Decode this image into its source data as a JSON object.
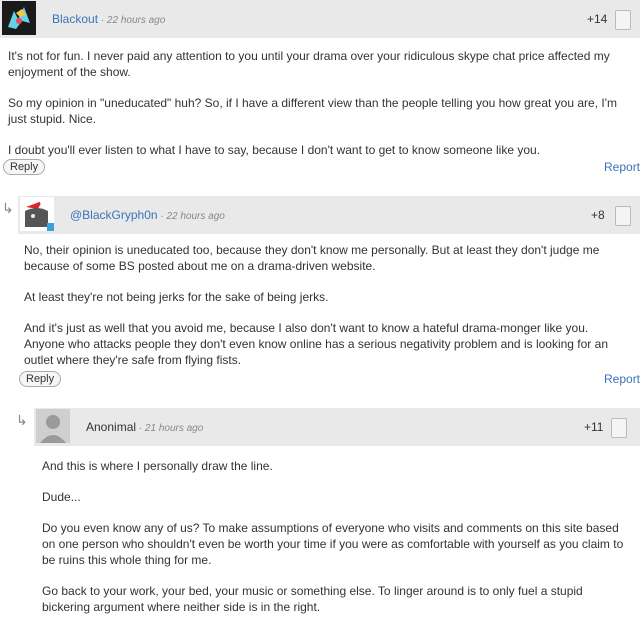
{
  "comments": [
    {
      "author": "Blackout",
      "time": "22 hours ago",
      "votes": "+14",
      "paragraphs": [
        "It's not for fun. I never paid any attention to you until your drama over your ridiculous skype chat price affected my enjoyment of the show.",
        "So my opinion in \"uneducated\" huh? So, if I have a different view than the people telling you how great you are, I'm just stupid. Nice.",
        "I doubt you'll ever listen to what I have to say, because I don't want to get to know someone like you."
      ],
      "reply_label": "Reply",
      "report_label": "Report"
    },
    {
      "author": "@BlackGryph0n",
      "time": "22 hours ago",
      "votes": "+8",
      "paragraphs": [
        "No, their opinion is uneducated too, because they don't know me personally. But at least they don't judge me because of some BS posted about me on a drama-driven website.",
        "At least they're not being jerks for the sake of being jerks.",
        "And it's just as well that you avoid me, because I also don't want to know a hateful drama-monger like you. Anyone who attacks people they don't even know online has a serious negativity problem and is looking for an outlet where they're safe from flying fists."
      ],
      "reply_label": "Reply",
      "report_label": "Report"
    },
    {
      "author": "Anonimal",
      "time": "21 hours ago",
      "votes": "+11",
      "paragraphs": [
        "And this is where I personally draw the line.",
        "Dude...",
        "Do you even know any of us? To make assumptions of everyone who visits and comments on this site based on one person who shouldn't even be worth your time if you were as comfortable with yourself as you claim to be ruins this whole thing for me.",
        "Go back to your work, your bed, your music or something else. To linger around is to only fuel a stupid bickering argument where neither side is in the right."
      ]
    }
  ],
  "colors": {
    "link": "#3b73b9",
    "header_bg": "#e9e9e9",
    "text": "#333333"
  }
}
